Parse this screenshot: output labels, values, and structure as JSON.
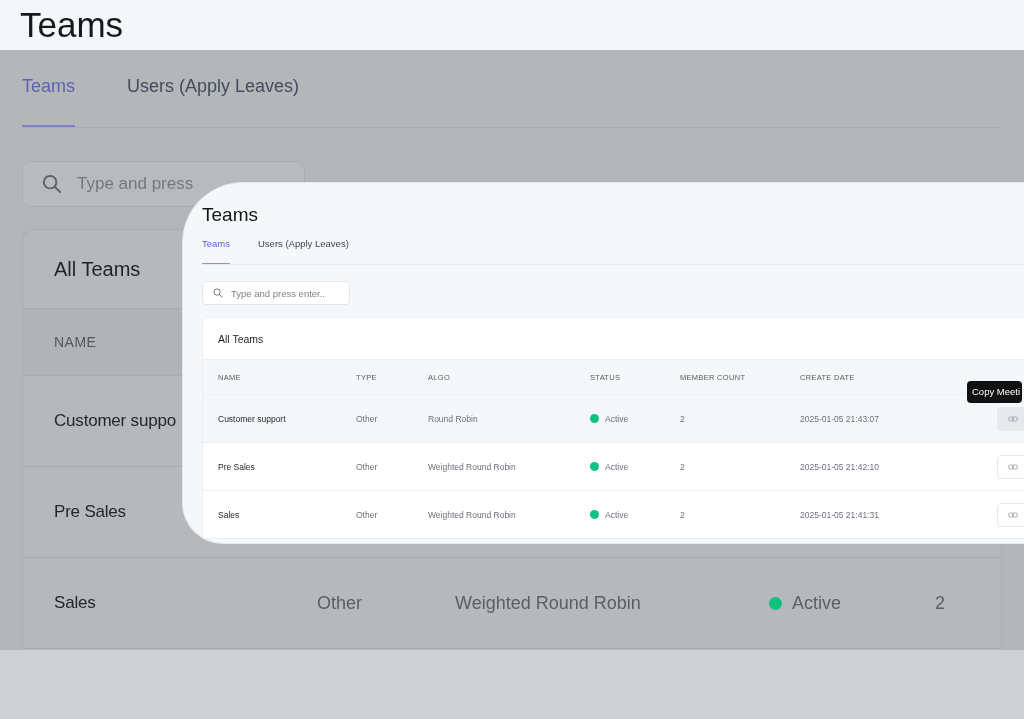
{
  "background": {
    "title": "Teams",
    "tabs": [
      {
        "label": "Teams",
        "selected": true
      },
      {
        "label": "Users (Apply Leaves)",
        "selected": false
      }
    ],
    "search": {
      "placeholder": "Type and press"
    },
    "card_title": "All Teams",
    "columns": [
      "NAME"
    ],
    "rows": [
      {
        "name": "Customer suppo"
      },
      {
        "name": "Pre Sales"
      },
      {
        "name": "Sales",
        "type": "Other",
        "algo": "Weighted Round Robin",
        "status": "Active",
        "color": "#10c27f",
        "member_count": "2"
      }
    ]
  },
  "inset": {
    "title": "Teams",
    "tabs": [
      {
        "label": "Teams",
        "selected": true
      },
      {
        "label": "Users (Apply Leaves)",
        "selected": false
      }
    ],
    "search": {
      "placeholder": "Type and press enter.."
    },
    "card_title": "All Teams",
    "columns": [
      "NAME",
      "TYPE",
      "ALGO",
      "STATUS",
      "MEMBER COUNT",
      "CREATE DATE"
    ],
    "rows": [
      {
        "name": "Customer support",
        "type": "Other",
        "algo": "Round Robin",
        "status": "Active",
        "color": "#10c27f",
        "member_count": "2",
        "create_date": "2025-01-05 21:43:07",
        "hovered": true
      },
      {
        "name": "Pre Sales",
        "type": "Other",
        "algo": "Weighted Round Robin",
        "status": "Active",
        "color": "#10c27f",
        "member_count": "2",
        "create_date": "2025-01-05 21:42:10",
        "hovered": false
      },
      {
        "name": "Sales",
        "type": "Other",
        "algo": "Weighted Round Robin",
        "status": "Active",
        "color": "#10c27f",
        "member_count": "2",
        "create_date": "2025-01-05 21:41:31",
        "hovered": false
      }
    ],
    "tooltip": "Copy Meeti"
  }
}
